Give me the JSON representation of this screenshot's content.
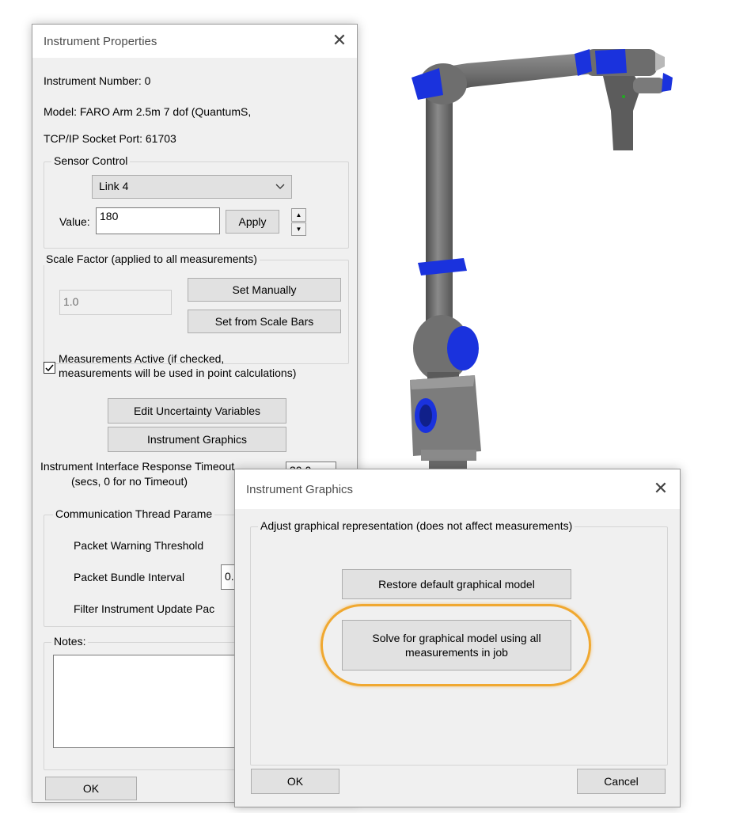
{
  "instrument_properties": {
    "title": "Instrument Properties",
    "instrument_number": "Instrument Number:  0",
    "model": "Model:  FARO Arm 2.5m 7 dof (QuantumS,",
    "port": "TCP/IP Socket Port: 61703",
    "sensor_control": {
      "label": "Sensor Control",
      "selected": "Link 4",
      "value_label": "Value:",
      "value": "180",
      "apply_label": "Apply"
    },
    "scale_factor": {
      "label": "Scale Factor (applied to all measurements)",
      "value": "1.0",
      "set_manually_label": "Set Manually",
      "set_scale_bars_label": "Set from Scale Bars"
    },
    "measurements_active": {
      "checked": true,
      "line1": "Measurements Active (if checked,",
      "line2": "measurements will be used in point calculations)"
    },
    "edit_uncertainty_label": "Edit Uncertainty Variables",
    "instrument_graphics_label": "Instrument Graphics",
    "timeout": {
      "line1": "Instrument Interface Response Timeout",
      "line2": "(secs, 0 for no Timeout)",
      "value": "30.0"
    },
    "comm_thread": {
      "label": "Communication Thread Parame",
      "packet_warning": "Packet Warning Threshold",
      "packet_bundle": "Packet Bundle Interval",
      "packet_bundle_value": "0.",
      "filter_update": "Filter Instrument Update Pac"
    },
    "notes_label": "Notes:",
    "ok_label": "OK"
  },
  "instrument_graphics": {
    "title": "Instrument Graphics",
    "group_label": "Adjust graphical representation (does not affect measurements)",
    "restore_label": "Restore default graphical model",
    "solve_line1": "Solve for graphical model using all",
    "solve_line2": "measurements in job",
    "ok_label": "OK",
    "cancel_label": "Cancel",
    "highlight_color": "#f0a830"
  },
  "arm_model": {
    "body_color": "#6b6b6b",
    "accent_color": "#1030e0"
  }
}
